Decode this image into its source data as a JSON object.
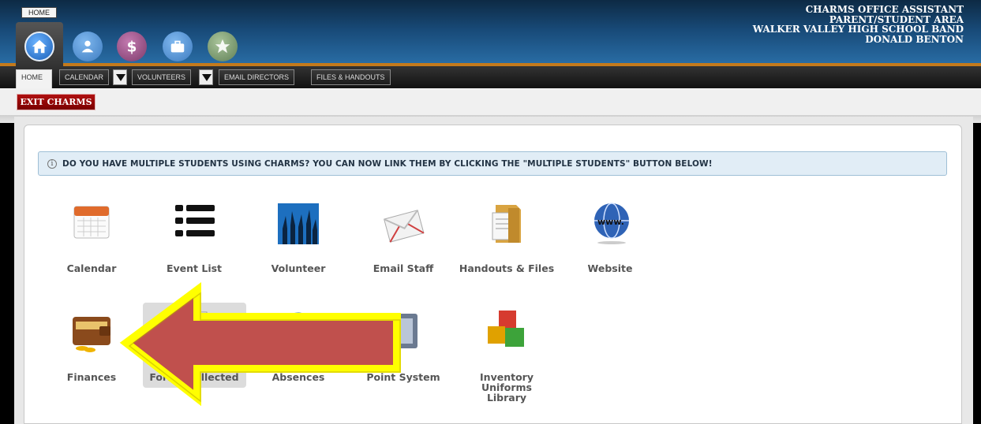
{
  "header": {
    "tooltip": "HOME",
    "info_lines": [
      "CHARMS OFFICE ASSISTANT",
      "PARENT/STUDENT AREA",
      "WALKER VALLEY HIGH SCHOOL BAND",
      "DONALD BENTON"
    ],
    "nav_icons": [
      "home-icon",
      "person-icon",
      "dollar-icon",
      "briefcase-icon",
      "star-icon"
    ],
    "colors": {
      "header_top": "#0d2a44",
      "header_bottom": "#2a6fa8",
      "accent_line": "#c47a1c"
    }
  },
  "tabs": {
    "home": "HOME",
    "calendar": "CALENDAR",
    "volunteers": "VOLUNTEERS",
    "email_directors": "EMAIL DIRECTORS",
    "files_handouts": "FILES & HANDOUTS"
  },
  "exit_button": "EXIT CHARMS",
  "notice": {
    "icon": "info-icon",
    "text": "DO YOU HAVE MULTIPLE STUDENTS USING CHARMS? YOU CAN NOW LINK THEM BY CLICKING THE \"MULTIPLE STUDENTS\" BUTTON BELOW!"
  },
  "tiles_row1": [
    {
      "label": "Calendar",
      "icon": "calendar-icon"
    },
    {
      "label": "Event List",
      "icon": "list-icon"
    },
    {
      "label": "Volunteer",
      "icon": "volunteer-icon"
    },
    {
      "label": "Email Staff",
      "icon": "envelope-icon"
    },
    {
      "label": "Handouts & Files",
      "icon": "folder-icon"
    },
    {
      "label": "Website",
      "icon": "globe-icon"
    }
  ],
  "tiles_row2": [
    {
      "label": "Finances",
      "icon": "wallet-icon"
    },
    {
      "label": "Forms Collected",
      "icon": "forms-icon"
    },
    {
      "label": "Absences",
      "icon": "absences-icon"
    },
    {
      "label": "Point System",
      "icon": "point-system-icon"
    },
    {
      "label": "Inventory\nUniforms\nLibrary",
      "icon": "boxes-icon"
    }
  ],
  "overlay": {
    "arrow_fill": "#c0504d",
    "arrow_outline": "#ffff00"
  }
}
